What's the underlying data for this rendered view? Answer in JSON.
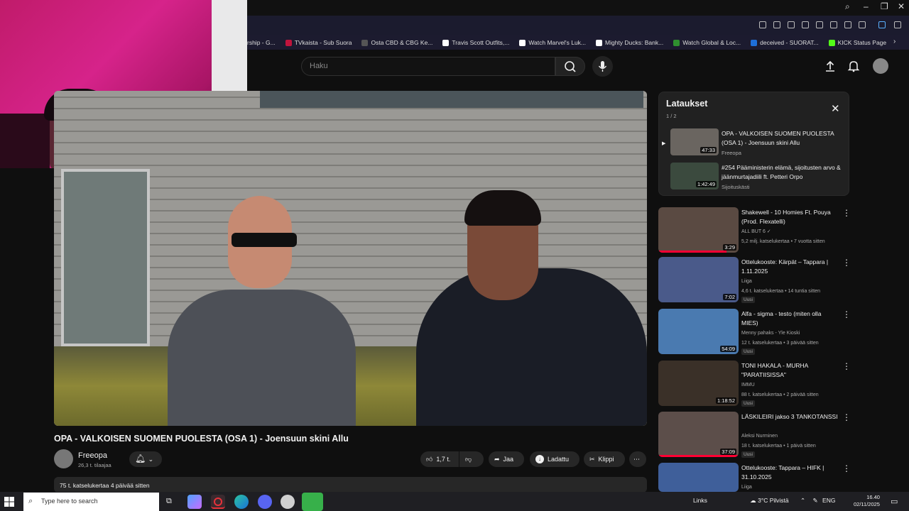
{
  "bookmarks": [
    {
      "label": "rship - G...",
      "color": "#888888"
    },
    {
      "label": "TVkaista - Sub Suora",
      "color": "#c0143c"
    },
    {
      "label": "Osta CBD & CBG Ke...",
      "color": "#555555"
    },
    {
      "label": "Travis Scott Outfits,...",
      "color": "#ffffff"
    },
    {
      "label": "Watch Marvel's Luk...",
      "color": "#ffffff"
    },
    {
      "label": "Mighty Ducks: Bank...",
      "color": "#ffffff"
    },
    {
      "label": "Watch Global & Loc...",
      "color": "#2f8f2f"
    },
    {
      "label": "deceived - SUORAT...",
      "color": "#1e6fd9"
    },
    {
      "label": "KICK Status Page",
      "color": "#53fc18"
    }
  ],
  "header": {
    "search_placeholder": "Haku"
  },
  "video": {
    "title": "OPA - VALKOISEN SUOMEN PUOLESTA (OSA 1) - Joensuun skini Allu",
    "channel": "Freeopa",
    "subscribers": "26,3 t. tilaajaa",
    "likes": "1,7 t.",
    "share_label": "Jaa",
    "download_label": "Ladattu",
    "clip_label": "Klippi",
    "description_meta": "75 t. katselukertaa  4 päivää sitten"
  },
  "downloads": {
    "title": "Lataukset",
    "count": "1 / 2",
    "items": [
      {
        "title": "OPA - VALKOISEN SUOMEN PUOLESTA (OSA 1) - Joensuun skini Allu",
        "channel": "Freeopa",
        "duration": "47:33",
        "thumb_color": "#6a6560"
      },
      {
        "title": "#254 Pääministerin elämä, sijoitusten arvo & jäänmurtajadiili ft. Petteri Orpo",
        "channel": "Sijoituskästi",
        "duration": "1:42:49",
        "thumb_color": "#3b4a3e"
      }
    ]
  },
  "recommendations": [
    {
      "title": "Shakewell - 10 Homies Ft. Pouya (Prod. Flexatelli)",
      "channel": "ALL BUT 6 ✓",
      "meta": "5,2 milj. katselukertaa • 7 vuotta sitten",
      "duration": "3:29",
      "badge": "",
      "thumb_color": "#5a4a42",
      "progress": 0.85
    },
    {
      "title": "Ottelukooste: Kärpät – Tappara | 1.11.2025",
      "channel": "Liiga",
      "meta": "4,6 t. katselukertaa • 14 tuntia sitten",
      "duration": "7:02",
      "badge": "Uusi",
      "thumb_color": "#4a5a8a",
      "progress": 0
    },
    {
      "title": "Alfa - sigma - testo (miten olla MIES)",
      "channel": "Menny pahaks - Yle Kioski",
      "meta": "12 t. katselukertaa • 3 päivää sitten",
      "duration": "54:09",
      "badge": "Uusi",
      "thumb_color": "#4a7ab0",
      "progress": 0
    },
    {
      "title": "TONI HAKALA -  MURHA \"PARATIISISSA\"",
      "channel": "IMMU",
      "meta": "88 t. katselukertaa • 2 päivää sitten",
      "duration": "1:18:52",
      "badge": "Uusi",
      "thumb_color": "#3a3028",
      "progress": 0
    },
    {
      "title": "LÄSKILEIRI jakso 3 TANKOTANSSI",
      "channel": "Aleksi Nurminen",
      "meta": "18 t. katselukertaa • 1 päivä sitten",
      "duration": "37:09",
      "badge": "Uusi",
      "thumb_color": "#5c4e4a",
      "progress": 1
    },
    {
      "title": "Ottelukooste: Tappara – HIFK | 31.10.2025",
      "channel": "Liiga",
      "meta": "",
      "duration": "",
      "badge": "",
      "thumb_color": "#3f5f9a",
      "progress": 0
    }
  ],
  "taskbar": {
    "search_placeholder": "Type here to search",
    "links": "Links",
    "weather": "3°C  Pilvistä",
    "lang": "ENG",
    "time": "16.40",
    "date": "02/11/2025"
  }
}
